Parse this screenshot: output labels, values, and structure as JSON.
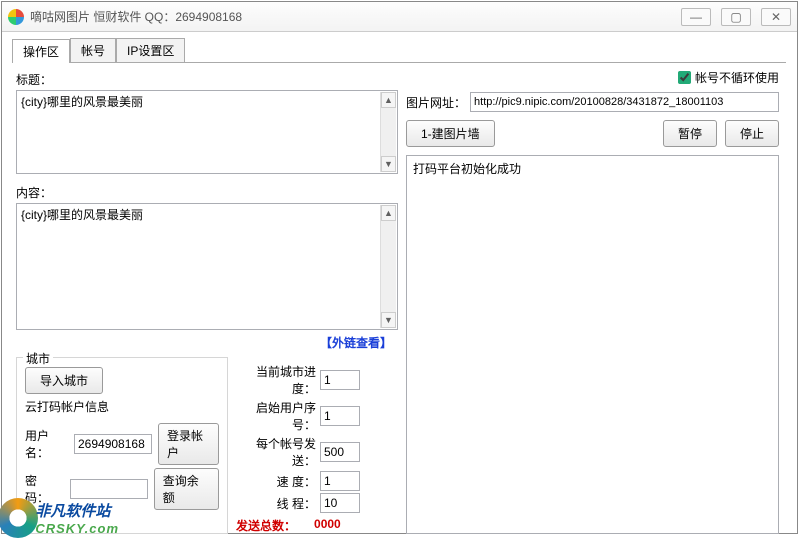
{
  "window": {
    "title": "嘀咕网图片  恒财软件  QQ：2694908168"
  },
  "tabs": {
    "items": [
      "操作区",
      "帐号",
      "IP设置区"
    ],
    "active": 0
  },
  "left": {
    "title_label": "标题：",
    "title_text": "{city}哪里的风景最美丽",
    "content_label": "内容：",
    "content_text": "{city}哪里的风景最美丽",
    "link_text": "【外链查看】",
    "city": {
      "legend": "城市",
      "import_btn": "导入城市",
      "cloud_info_label": "云打码帐户信息",
      "username_label": "用户名：",
      "username_value": "2694908168",
      "login_btn": "登录帐户",
      "password_label": "密   码：",
      "password_value": "",
      "balance_btn": "查询余额"
    },
    "stats": {
      "cur_city_label": "当前城市进度：",
      "cur_city_val": "1",
      "start_user_label": "启始用户序号：",
      "start_user_val": "1",
      "per_account_label": "每个帐号发送：",
      "per_account_val": "500",
      "speed_label": "速            度：",
      "speed_val": "1",
      "thread_label": "线            程：",
      "thread_val": "10",
      "send_total_label": "发送总数：",
      "send_total_val": "0000"
    }
  },
  "right": {
    "no_loop_label": "帐号不循环使用",
    "image_url_label": "图片网址：",
    "image_url_value": "http://pic9.nipic.com/20100828/3431872_18001103",
    "build_wall_btn": "1-建图片墙",
    "pause_btn": "暂停",
    "stop_btn": "停止",
    "log_text": "打码平台初始化成功"
  },
  "watermark": {
    "cn": "非凡软件站",
    "en": "CRSKY.com"
  }
}
